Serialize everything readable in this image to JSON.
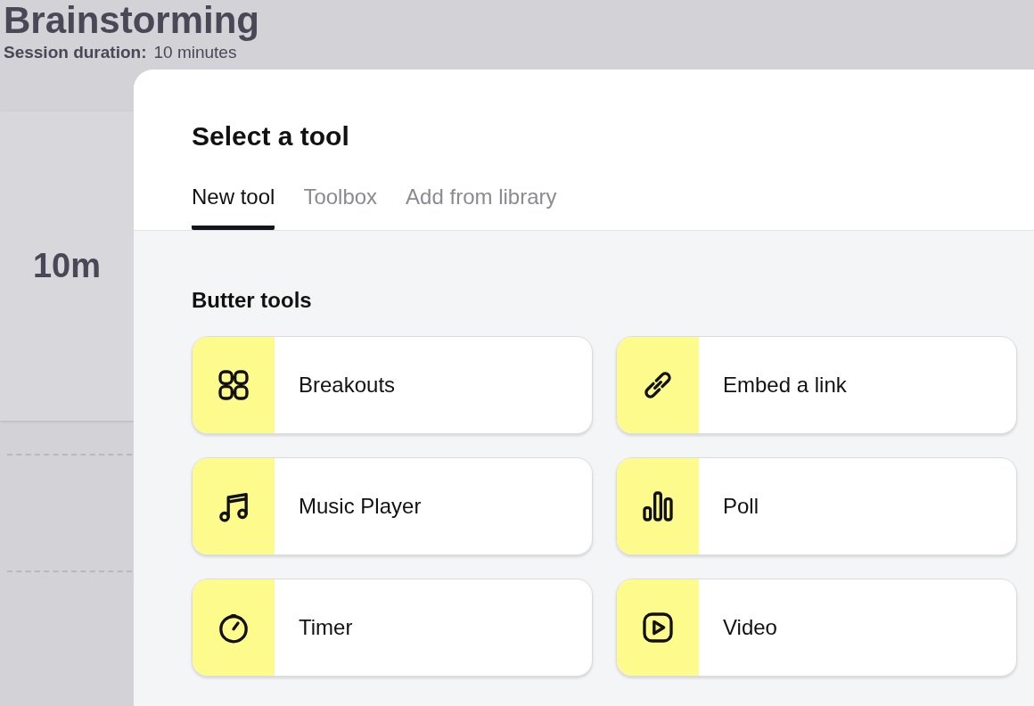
{
  "background": {
    "title": "Brainstorming",
    "duration_label": "Session duration:",
    "duration_value": "10 minutes",
    "timer_card": "10m"
  },
  "dialog": {
    "title": "Select a tool",
    "tabs": [
      {
        "label": "New tool",
        "selected": true
      },
      {
        "label": "Toolbox",
        "selected": false
      },
      {
        "label": "Add from library",
        "selected": false
      }
    ],
    "section_title": "Butter tools",
    "tools": [
      {
        "label": "Breakouts",
        "kind": "grid"
      },
      {
        "label": "Embed a link",
        "kind": "link"
      },
      {
        "label": "Music Player",
        "kind": "music"
      },
      {
        "label": "Poll",
        "kind": "bars"
      },
      {
        "label": "Timer",
        "kind": "timer"
      },
      {
        "label": "Video",
        "kind": "video"
      }
    ]
  }
}
